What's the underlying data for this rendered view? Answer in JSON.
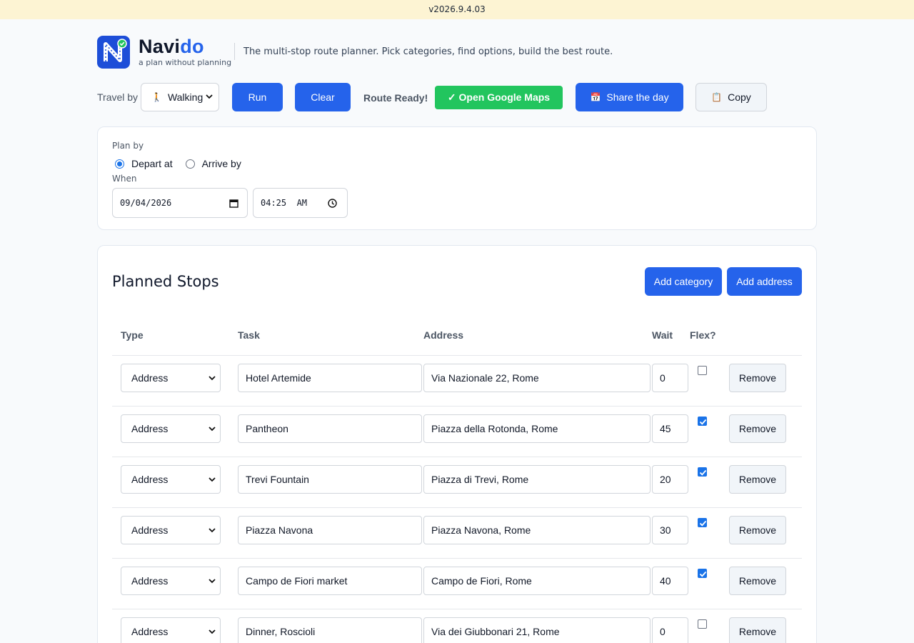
{
  "version": "v2026.9.4.03",
  "brand": {
    "name_part1": "Navi",
    "name_part2": "do",
    "tagline": "a plan without planning",
    "description": "The multi-stop route planner. Pick categories, find options, build the best route.",
    "accent": "#2563eb"
  },
  "toolbar": {
    "travel_label": "Travel by",
    "travel_icon": "walking-person-icon",
    "travel_value": "Walking",
    "run_label": "Run",
    "clear_label": "Clear",
    "status": "Route Ready!",
    "open_maps_label": "✓ Open Google Maps",
    "share_icon": "calendar-icon",
    "share_label": "Share the day",
    "copy_icon": "clipboard-icon",
    "copy_label": "Copy"
  },
  "plan": {
    "plan_by_label": "Plan by",
    "options": [
      "Depart at",
      "Arrive by"
    ],
    "selected": "Depart at",
    "when_label": "When",
    "date": "09/04/2026",
    "time": "04:25  AM"
  },
  "stops": {
    "title": "Planned Stops",
    "add_category_label": "Add category",
    "add_address_label": "Add address",
    "columns": [
      "Type",
      "Task",
      "Address",
      "Wait",
      "Flex?"
    ],
    "remove_label": "Remove",
    "rows": [
      {
        "type": "Address",
        "task": "Hotel Artemide",
        "address": "Via Nazionale 22, Rome",
        "wait": "0",
        "flex": false
      },
      {
        "type": "Address",
        "task": "Pantheon",
        "address": "Piazza della Rotonda, Rome",
        "wait": "45",
        "flex": true
      },
      {
        "type": "Address",
        "task": "Trevi Fountain",
        "address": "Piazza di Trevi, Rome",
        "wait": "20",
        "flex": true
      },
      {
        "type": "Address",
        "task": "Piazza Navona",
        "address": "Piazza Navona, Rome",
        "wait": "30",
        "flex": true
      },
      {
        "type": "Address",
        "task": "Campo de Fiori market",
        "address": "Campo de Fiori, Rome",
        "wait": "40",
        "flex": true
      },
      {
        "type": "Address",
        "task": "Dinner, Roscioli",
        "address": "Via dei Giubbonari 21, Rome",
        "wait": "0",
        "flex": false
      }
    ]
  }
}
